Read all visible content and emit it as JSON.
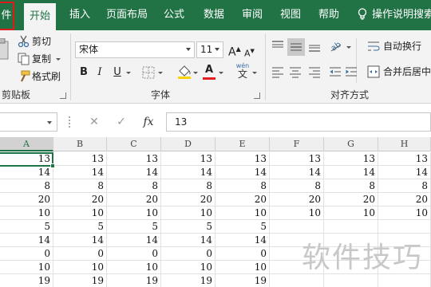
{
  "tabs": {
    "file": "件",
    "home": "开始",
    "insert": "插入",
    "page_layout": "页面布局",
    "formulas": "公式",
    "data": "数据",
    "review": "审阅",
    "view": "视图",
    "help": "帮助",
    "tell_me": "操作说明搜索"
  },
  "clipboard": {
    "cut": "剪切",
    "copy": "复制",
    "format_painter": "格式刷",
    "group_label": "剪贴板"
  },
  "font": {
    "name": "宋体",
    "size": "11",
    "grow": "A",
    "shrink": "A",
    "bold": "B",
    "italic": "I",
    "underline": "U",
    "font_color_letter": "A",
    "phonetic_top": "wén",
    "phonetic_bottom": "文",
    "group_label": "字体"
  },
  "alignment": {
    "wrap_text": "自动换行",
    "merge_center": "合并后居中",
    "group_label": "对齐方式"
  },
  "formula_bar": {
    "fx": "fx",
    "value": "13"
  },
  "sheet": {
    "columns": [
      "A",
      "B",
      "C",
      "D",
      "E",
      "F",
      "G",
      "H"
    ],
    "rows": [
      [
        "13",
        "13",
        "13",
        "13",
        "13",
        "13",
        "13",
        "13"
      ],
      [
        "14",
        "14",
        "14",
        "14",
        "14",
        "14",
        "14",
        "14"
      ],
      [
        "8",
        "8",
        "8",
        "8",
        "8",
        "8",
        "8",
        "8"
      ],
      [
        "20",
        "20",
        "20",
        "20",
        "20",
        "20",
        "20",
        "20"
      ],
      [
        "10",
        "10",
        "10",
        "10",
        "10",
        "10",
        "10",
        "10"
      ],
      [
        "5",
        "5",
        "5",
        "5",
        "5",
        "",
        "",
        ""
      ],
      [
        "14",
        "14",
        "14",
        "14",
        "14",
        "",
        "",
        ""
      ],
      [
        "0",
        "0",
        "0",
        "0",
        "0",
        "",
        "",
        ""
      ],
      [
        "10",
        "10",
        "10",
        "10",
        "10",
        "",
        "",
        ""
      ],
      [
        "19",
        "19",
        "19",
        "19",
        "19",
        "",
        "",
        ""
      ]
    ]
  },
  "watermark": "软件技巧",
  "colors": {
    "brand": "#217346",
    "file_highlight": "#e01b1b",
    "font_color_bar": "#e02020",
    "fill_color_bar": "#f5d400"
  }
}
